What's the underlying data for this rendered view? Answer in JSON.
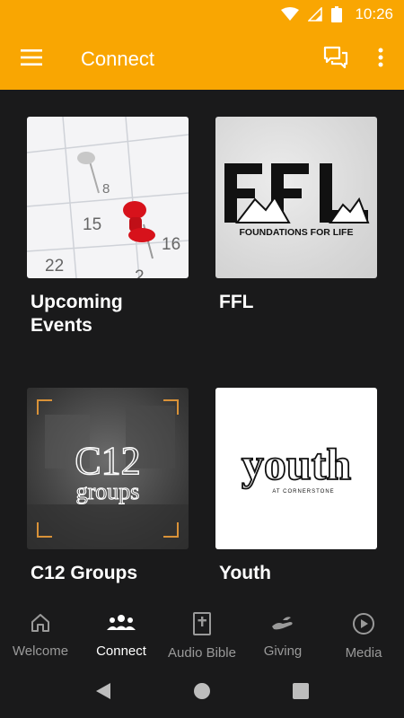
{
  "status_bar": {
    "time": "10:26"
  },
  "app_bar": {
    "title": "Connect"
  },
  "tiles": [
    {
      "label": "Upcoming Events",
      "thumb": {
        "dates": [
          "8",
          "15",
          "16",
          "22",
          "2"
        ]
      }
    },
    {
      "label": "FFL",
      "thumb": {
        "logo_text": "FFL",
        "tagline": "FOUNDATIONS FOR LIFE"
      }
    },
    {
      "label": "C12 Groups",
      "thumb": {
        "line1": "C12",
        "line2": "groups"
      }
    },
    {
      "label": "Youth",
      "thumb": {
        "word": "youth",
        "sub": "AT CORNERSTONE"
      }
    }
  ],
  "bottom_nav": [
    {
      "label": "Welcome",
      "icon": "home-icon",
      "active": false
    },
    {
      "label": "Connect",
      "icon": "people-icon",
      "active": true
    },
    {
      "label": "Audio Bible",
      "icon": "bible-icon",
      "active": false
    },
    {
      "label": "Giving",
      "icon": "giving-hand-icon",
      "active": false
    },
    {
      "label": "Media",
      "icon": "play-circle-icon",
      "active": false
    }
  ],
  "colors": {
    "accent": "#f9a602",
    "background": "#1a1a1b",
    "nav_inactive": "#9a9a9a"
  }
}
